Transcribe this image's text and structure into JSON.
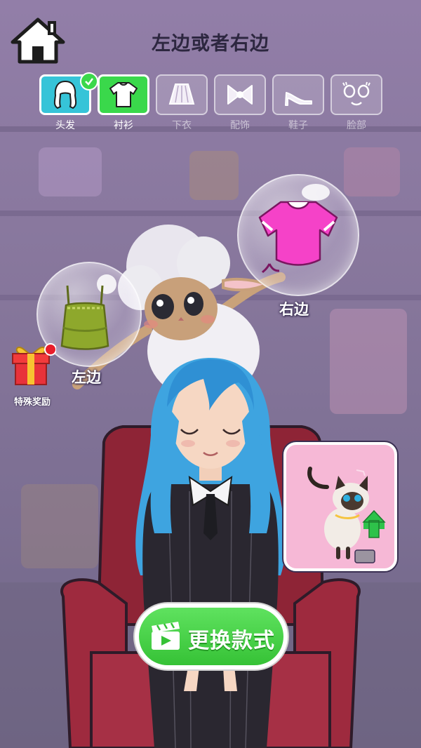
{
  "header": {
    "title": "左边或者右边"
  },
  "tabs": [
    {
      "label": "头发",
      "state": "done",
      "icon": "hair-icon"
    },
    {
      "label": "衬衫",
      "state": "active",
      "icon": "shirt-icon"
    },
    {
      "label": "下衣",
      "state": "locked",
      "icon": "skirt-icon"
    },
    {
      "label": "配饰",
      "state": "locked",
      "icon": "bow-icon"
    },
    {
      "label": "鞋子",
      "state": "locked",
      "icon": "heel-icon"
    },
    {
      "label": "脸部",
      "state": "locked",
      "icon": "face-icon"
    }
  ],
  "choices": {
    "left": {
      "label": "左边",
      "item": "green-camisole-icon"
    },
    "right": {
      "label": "右边",
      "item": "pink-crop-top-icon"
    }
  },
  "reward": {
    "label": "特殊奖励"
  },
  "cta": {
    "label": "更换款式"
  },
  "colors": {
    "active_tab": "#3ad84b",
    "done_tab": "#36c4d8",
    "cta_green": "#3ec93e",
    "pet_card": "#f6b8d6"
  }
}
